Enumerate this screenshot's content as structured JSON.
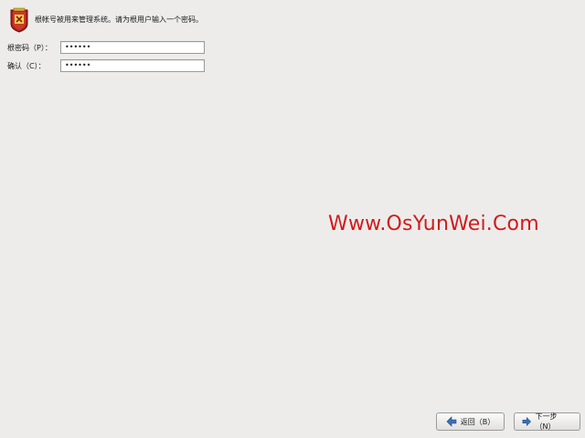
{
  "header": {
    "message": "根帐号被用来管理系统。请为根用户输入一个密码。",
    "logo_icon": "shield-icon"
  },
  "form": {
    "password_label": "根密码（P）：",
    "password_value": "••••••",
    "confirm_label": "确认（C）：",
    "confirm_value": "••••••"
  },
  "watermark": {
    "text": "Www.OsYunWei.Com",
    "color": "#d31a1a"
  },
  "buttons": {
    "back_label": "返回（B）",
    "back_icon": "arrow-left-icon",
    "next_label": "下一步（N）",
    "next_icon": "arrow-right-icon"
  }
}
